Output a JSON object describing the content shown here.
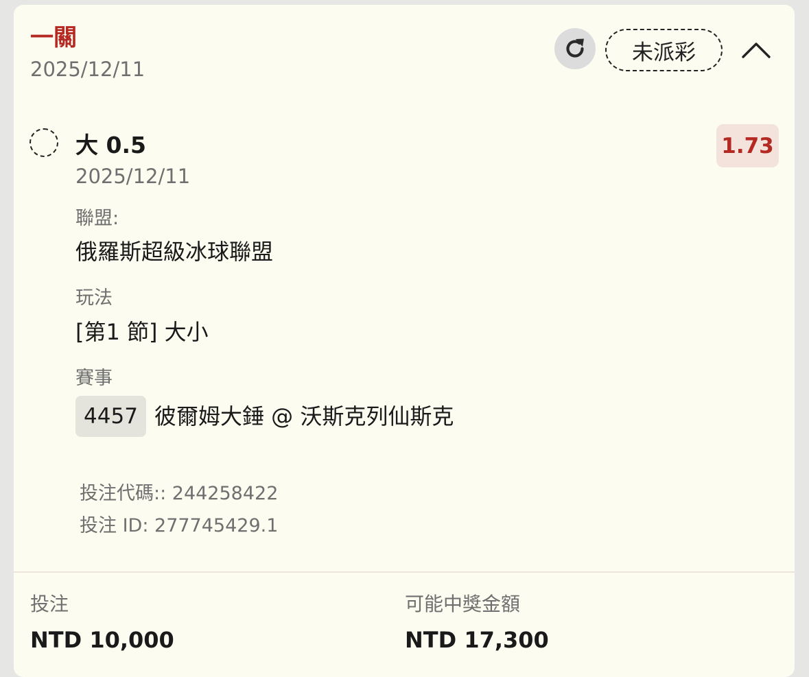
{
  "header": {
    "bet_type": "一關",
    "date": "2025/12/11",
    "status": "未派彩"
  },
  "icons": {
    "refresh": "refresh-icon",
    "collapse": "chevron-up-icon",
    "radio": "dashed-circle-icon"
  },
  "selection": {
    "name": "大 0.5",
    "date": "2025/12/11",
    "odds": "1.73",
    "league_label": "聯盟:",
    "league_value": "俄羅斯超級冰球聯盟",
    "market_label": "玩法",
    "market_value": "[第1 節] 大小",
    "event_label": "賽事",
    "event_id": "4457",
    "event_name": "彼爾姆大錘 @ 沃斯克列仙斯克"
  },
  "meta": {
    "bet_code": "投注代碼:: 244258422",
    "bet_id": "投注 ID: 277745429.1"
  },
  "summary": {
    "stake_label": "投注",
    "stake_value": "NTD 10,000",
    "payout_label": "可能中獎金額",
    "payout_value": "NTD 17,300"
  },
  "colors": {
    "accent": "#b42a23",
    "card_bg": "#fcfcf0",
    "odds_bg": "#f3e3dc"
  }
}
